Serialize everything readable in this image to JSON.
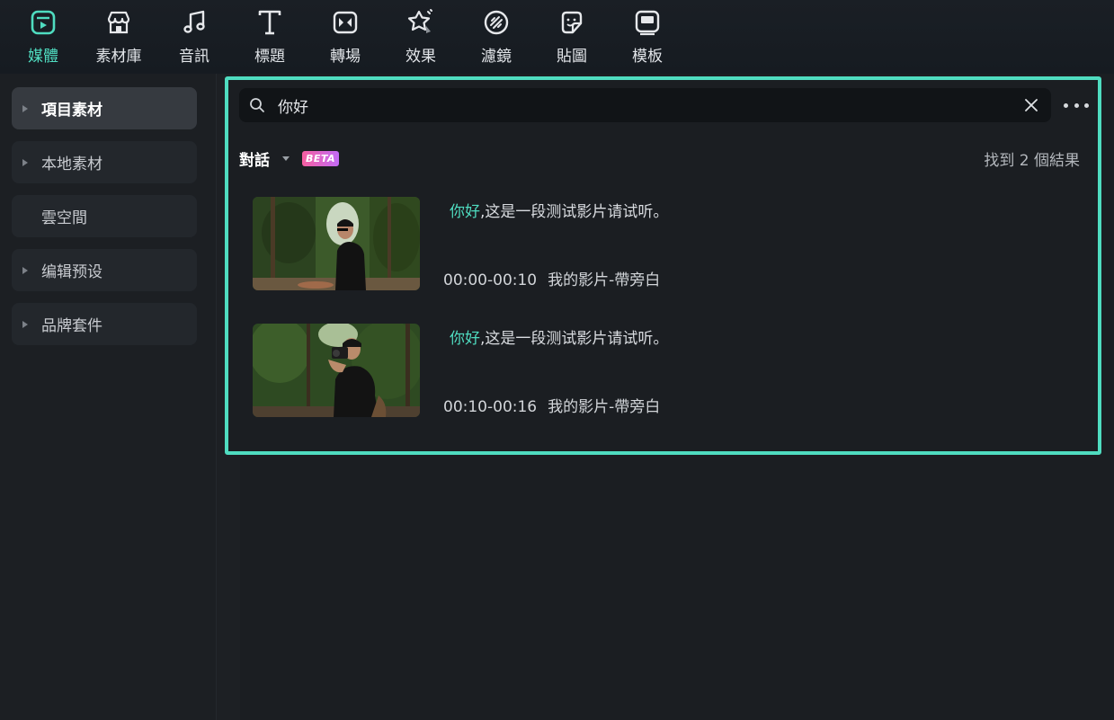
{
  "toolbar": {
    "items": [
      {
        "label": "媒體",
        "icon": "media-icon",
        "active": true
      },
      {
        "label": "素材庫",
        "icon": "store-icon"
      },
      {
        "label": "音訊",
        "icon": "music-note-icon"
      },
      {
        "label": "標題",
        "icon": "title-t-icon"
      },
      {
        "label": "轉場",
        "icon": "transition-icon"
      },
      {
        "label": "效果",
        "icon": "effects-star-icon"
      },
      {
        "label": "濾鏡",
        "icon": "filter-icon"
      },
      {
        "label": "貼圖",
        "icon": "sticker-icon"
      },
      {
        "label": "模板",
        "icon": "template-icon"
      }
    ],
    "accent_color": "#4fdcc0"
  },
  "sidebar": {
    "items": [
      {
        "label": "項目素材",
        "expandable": true,
        "active": true
      },
      {
        "label": "本地素材",
        "expandable": true
      },
      {
        "label": "雲空間",
        "expandable": false
      },
      {
        "label": "编辑预设",
        "expandable": true
      },
      {
        "label": "品牌套件",
        "expandable": true
      }
    ]
  },
  "search": {
    "value": "你好"
  },
  "filter": {
    "label": "對話",
    "badge": "BETA"
  },
  "result_count": "找到 2 個結果",
  "results": [
    {
      "highlight": "你好",
      "text": ",这是一段测试影片请试听。",
      "time": "00:00-00:10",
      "source": "我的影片-帶旁白"
    },
    {
      "highlight": "你好",
      "text": ",这是一段测试影片请试听。",
      "time": "00:10-00:16",
      "source": "我的影片-帶旁白"
    }
  ]
}
